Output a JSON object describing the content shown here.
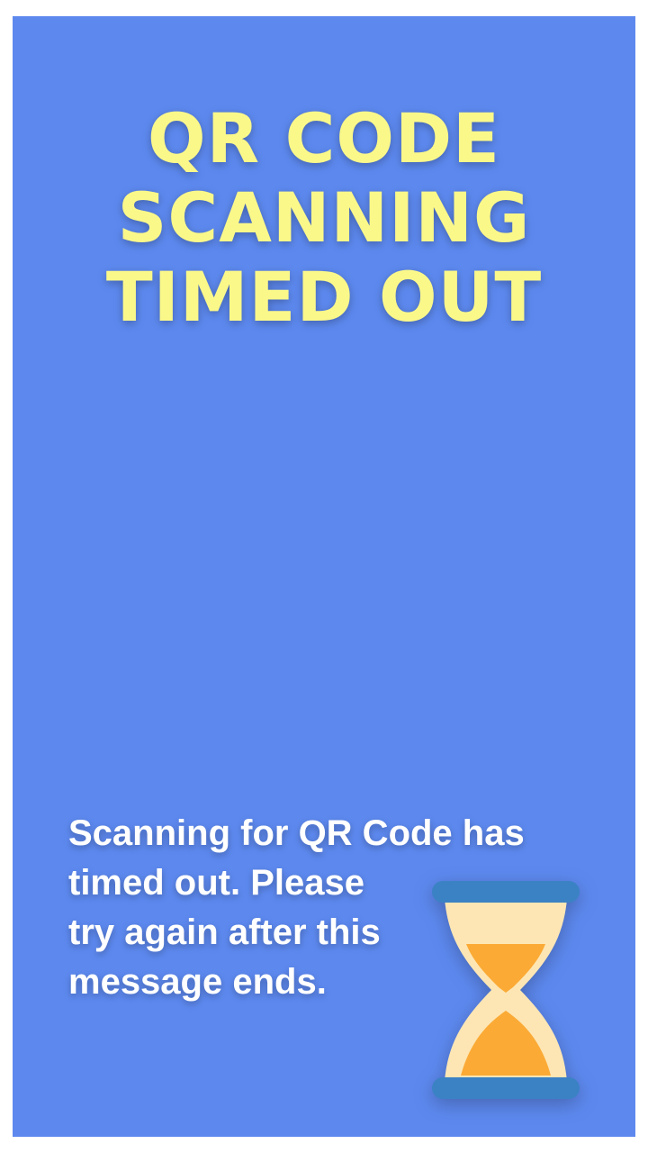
{
  "title": {
    "lines": [
      "QR CODE",
      "SCANNING",
      "TIMED OUT"
    ]
  },
  "message": {
    "lines": [
      "Scanning for QR Code has",
      "timed out. Please",
      "try again after this",
      "message ends."
    ]
  },
  "icon": {
    "name": "hourglass-icon"
  },
  "colors": {
    "background": "#5d89ef",
    "title": "#fbf88a",
    "message": "#ffffff",
    "hourglass_frame": "#3b82c4",
    "hourglass_glass": "#fde6b4",
    "hourglass_sand": "#fbaa35"
  }
}
